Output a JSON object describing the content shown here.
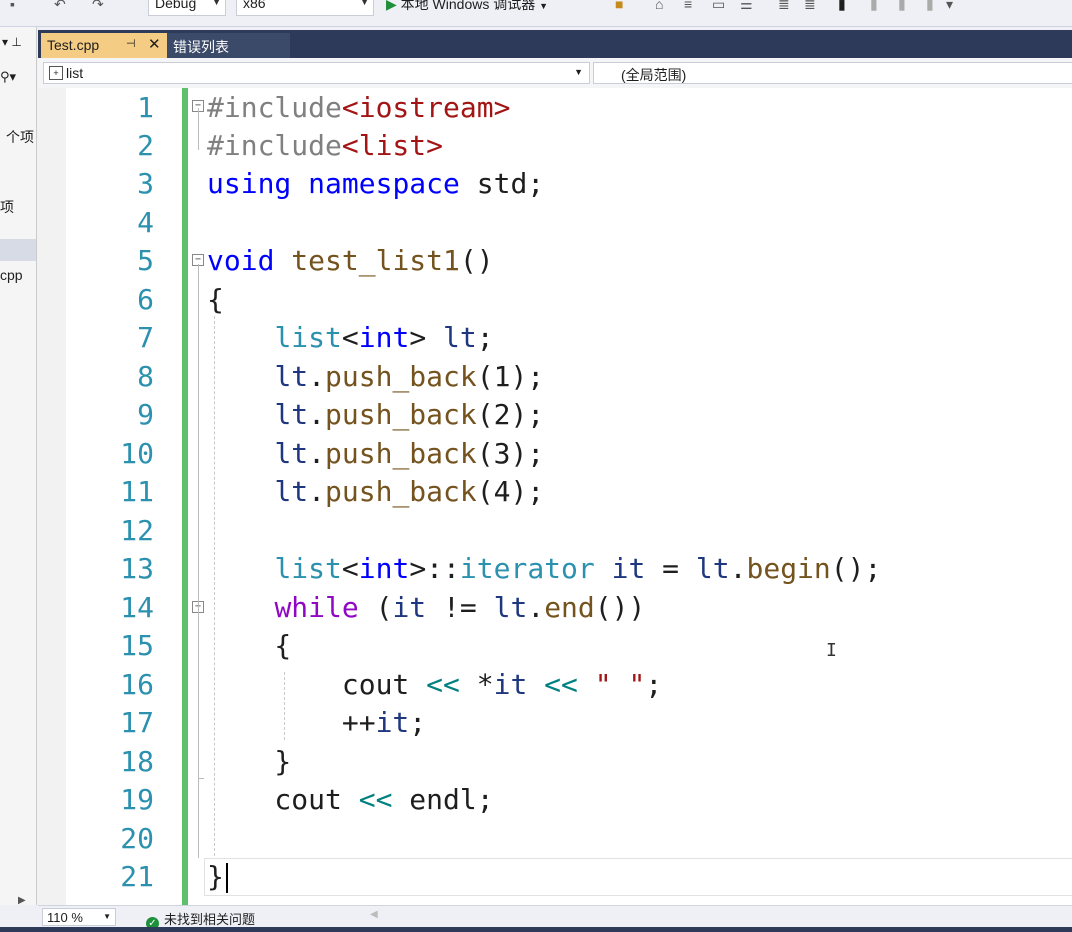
{
  "toolbar": {
    "config": "Debug",
    "platform": "x86",
    "run_label": "本地 Windows 调试器"
  },
  "left_panel": {
    "text1": "个项",
    "text2": "项",
    "text3": "cpp"
  },
  "tabs": [
    {
      "label": "Test.cpp",
      "active": true
    },
    {
      "label": "错误列表",
      "active": false
    }
  ],
  "nav": {
    "scope_left": "list",
    "scope_right": "(全局范围)"
  },
  "editor": {
    "line_numbers": [
      "1",
      "2",
      "3",
      "4",
      "5",
      "6",
      "7",
      "8",
      "9",
      "10",
      "11",
      "12",
      "13",
      "14",
      "15",
      "16",
      "17",
      "18",
      "19",
      "20",
      "21"
    ],
    "lines": [
      "#include<iostream>",
      "#include<list>",
      "using namespace std;",
      "",
      "void test_list1()",
      "{",
      "    list<int> lt;",
      "    lt.push_back(1);",
      "    lt.push_back(2);",
      "    lt.push_back(3);",
      "    lt.push_back(4);",
      "",
      "    list<int>::iterator it = lt.begin();",
      "    while (it != lt.end())",
      "    {",
      "        cout << *it << \" \";",
      "        ++it;",
      "    }",
      "    cout << endl;",
      "",
      "}"
    ]
  },
  "status": {
    "zoom": "110 %",
    "issues": "未找到相关问题"
  },
  "colors": {
    "tab_active": "#f5cc84",
    "tab_bar": "#2d3a5a",
    "change_bar": "#5ec06a",
    "line_number": "#2b91af"
  }
}
